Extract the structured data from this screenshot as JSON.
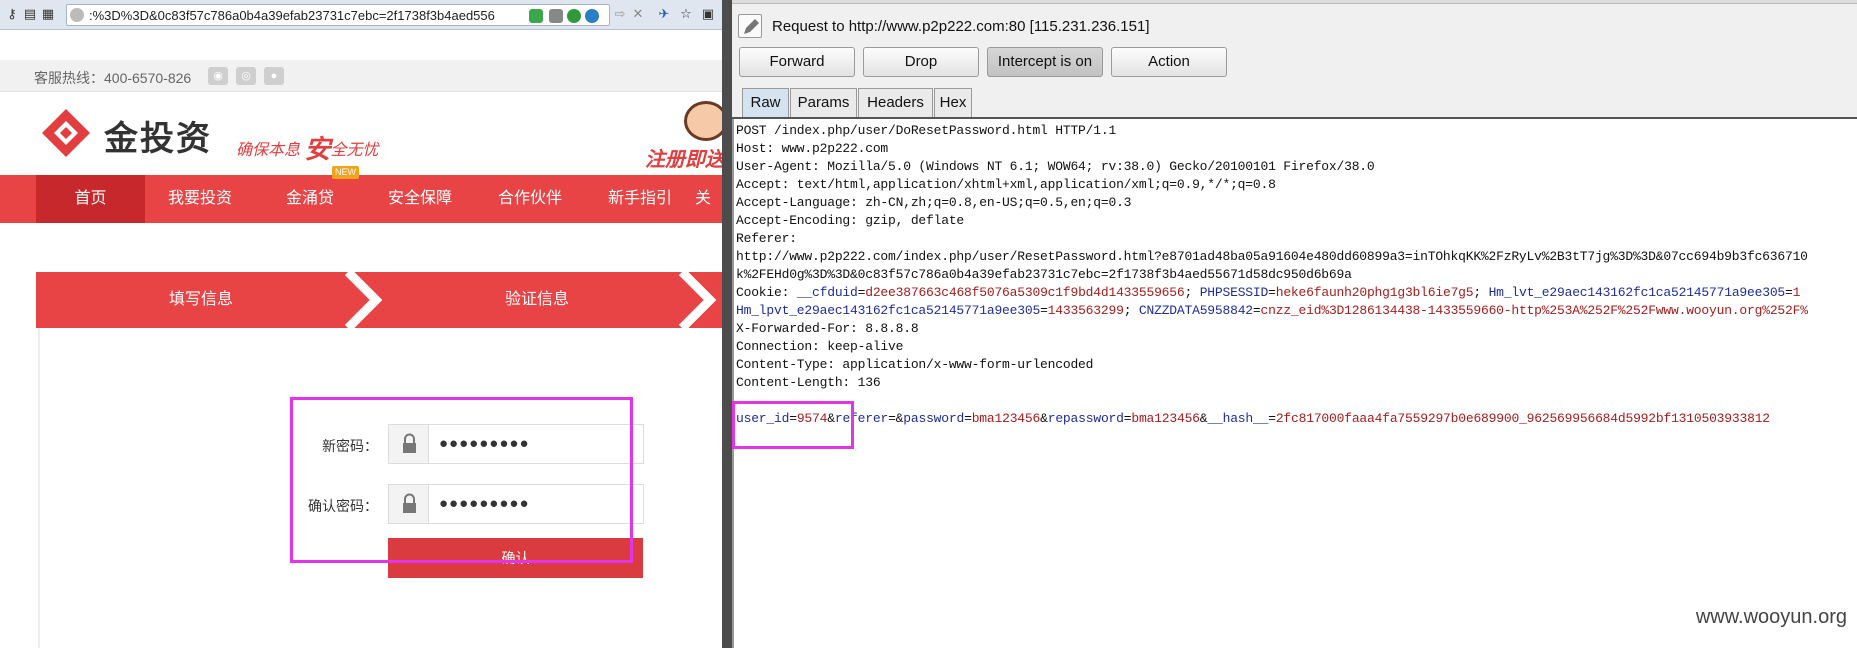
{
  "browser": {
    "url": ":%3D%3D&0c83f57c786a0b4a39efab23731c7ebc=2f1738f3b4aed556",
    "hotline": "客服热线：400-6570-826",
    "brand": "金投资",
    "slogan_a": "确保本息",
    "slogan_big": "安",
    "slogan_b": "全无忧",
    "register_badge": "注册即送",
    "nav": [
      "首页",
      "我要投资",
      "金涌贷",
      "安全保障",
      "合作伙伴",
      "新手指引",
      "关"
    ],
    "nav_new_tag": "NEW",
    "steps": [
      "填写信息",
      "验证信息"
    ],
    "form": {
      "new_password_label": "新密码：",
      "confirm_password_label": "确认密码：",
      "new_password_value": "●●●●●●●●●",
      "confirm_password_value": "●●●●●●●●●",
      "confirm_button": "确认"
    }
  },
  "burp": {
    "request_title": "Request to http://www.p2p222.com:80  [115.231.236.151]",
    "buttons": [
      "Forward",
      "Drop",
      "Intercept is on",
      "Action"
    ],
    "tabs": [
      "Raw",
      "Params",
      "Headers",
      "Hex"
    ],
    "active_tab": "Raw",
    "raw_lines": [
      "POST /index.php/user/DoResetPassword.html HTTP/1.1",
      "Host: www.p2p222.com",
      "User-Agent: Mozilla/5.0 (Windows NT 6.1; WOW64; rv:38.0) Gecko/20100101 Firefox/38.0",
      "Accept: text/html,application/xhtml+xml,application/xml;q=0.9,*/*;q=0.8",
      "Accept-Language: zh-CN,zh;q=0.8,en-US;q=0.5,en;q=0.3",
      "Accept-Encoding: gzip, deflate",
      "Referer:",
      "http://www.p2p222.com/index.php/user/ResetPassword.html?e8701ad48ba05a91604e480dd60899a3=inTOhkqKK%2FzRyLv%2B3tT7jg%3D%3D&07cc694b9b3fc636710",
      "k%2FEHd0g%3D%3D&0c83f57c786a0b4a39efab23731c7ebc=2f1738f3b4aed55671d58dc950d6b69a"
    ],
    "cookie_line1": {
      "prefix": "Cookie: ",
      "k1": "__cfduid",
      "v1": "d2ee387663c468f5076a5309c1f9bd4d1433559656",
      "k2": "PHPSESSID",
      "v2": "heke6faunh20phg1g3bl6ie7g5",
      "k3": "Hm_lvt_e29aec143162fc1ca52145771a9ee305",
      "v3": "1"
    },
    "cookie_line2": {
      "k1": "Hm_lpvt_e29aec143162fc1ca52145771a9ee305",
      "v1": "1433563299",
      "k2": "CNZZDATA5958842",
      "v2": "cnzz_eid%3D1286134438-1433559660-http%253A%252F%252Fwww.wooyun.org%252F%"
    },
    "raw_lines_after": [
      "X-Forwarded-For: 8.8.8.8",
      "Connection: keep-alive",
      "Content-Type: application/x-www-form-urlencoded",
      "Content-Length: 136"
    ],
    "body": {
      "k1": "user_id",
      "v1": "9574",
      "k2": "referer",
      "v2": "",
      "k3": "password",
      "v3": "bma123456",
      "k4": "repassword",
      "v4": "bma123456",
      "k5": "__hash__",
      "v5": "2fc817000faaa4fa7559297b0e689900_962569956684d5992bf1310503933812"
    },
    "watermark": "www.wooyun.org"
  },
  "colors": {
    "brand_red": "#e84345",
    "highlight": "#e235e8",
    "param_key": "#1f2d9c",
    "param_value": "#a51d1d"
  }
}
